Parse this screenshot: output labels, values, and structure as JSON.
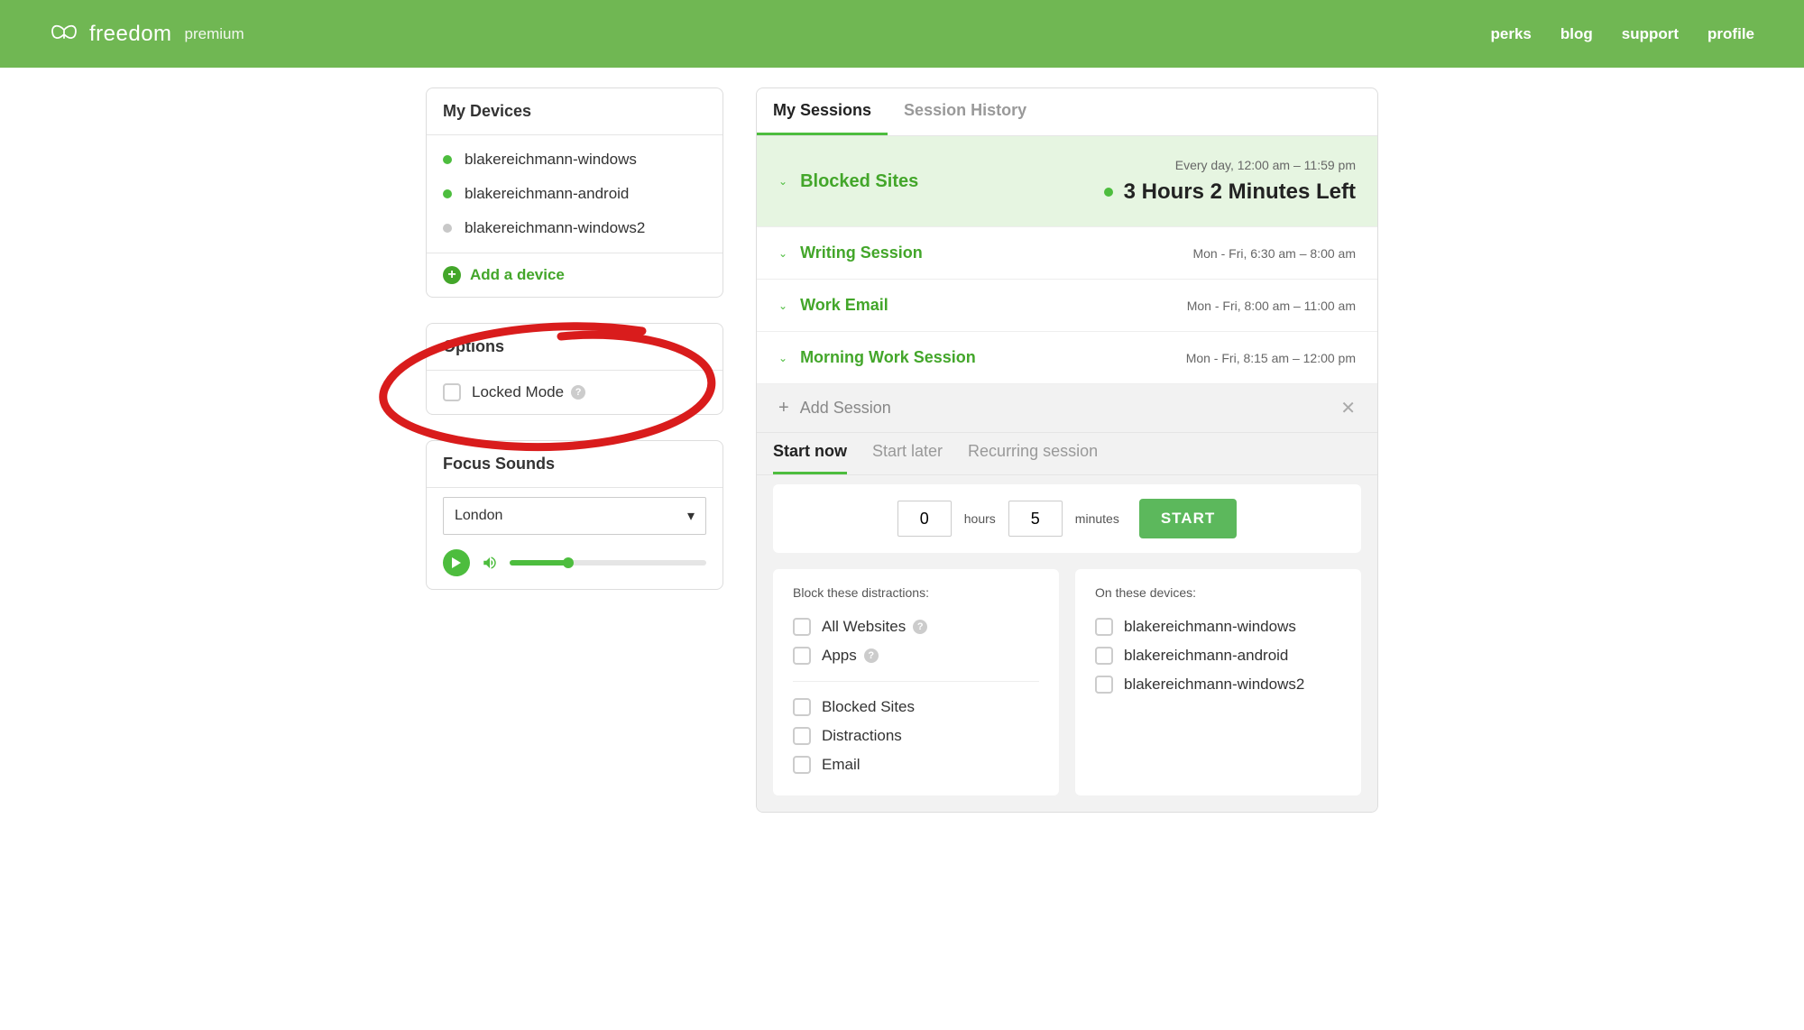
{
  "header": {
    "brand": "freedom",
    "tier": "premium",
    "nav": [
      "perks",
      "blog",
      "support",
      "profile"
    ]
  },
  "devices": {
    "title": "My Devices",
    "items": [
      {
        "name": "blakereichmann-windows",
        "online": true
      },
      {
        "name": "blakereichmann-android",
        "online": true
      },
      {
        "name": "blakereichmann-windows2",
        "online": false
      }
    ],
    "add_label": "Add a device"
  },
  "options": {
    "title": "Options",
    "locked_mode_label": "Locked Mode"
  },
  "sounds": {
    "title": "Focus Sounds",
    "selected": "London"
  },
  "sessions": {
    "tabs": {
      "my": "My Sessions",
      "history": "Session History"
    },
    "list": [
      {
        "name": "Blocked Sites",
        "schedule": "Every day, 12:00 am – 11:59 pm",
        "time_left": "3 Hours 2 Minutes Left",
        "active": true
      },
      {
        "name": "Writing Session",
        "schedule": "Mon - Fri, 6:30 am – 8:00 am"
      },
      {
        "name": "Work Email",
        "schedule": "Mon - Fri, 8:00 am – 11:00 am"
      },
      {
        "name": "Morning Work Session",
        "schedule": "Mon - Fri, 8:15 am – 12:00 pm"
      }
    ],
    "add_label": "Add Session",
    "sub_tabs": {
      "now": "Start now",
      "later": "Start later",
      "recurring": "Recurring session"
    },
    "start": {
      "hours": "0",
      "hours_label": "hours",
      "minutes": "5",
      "minutes_label": "minutes",
      "button": "START"
    },
    "distractions": {
      "title": "Block these distractions:",
      "top": [
        "All Websites",
        "Apps"
      ],
      "lists": [
        "Blocked Sites",
        "Distractions",
        "Email"
      ]
    },
    "on_devices": {
      "title": "On these devices:",
      "items": [
        "blakereichmann-windows",
        "blakereichmann-android",
        "blakereichmann-windows2"
      ]
    }
  }
}
